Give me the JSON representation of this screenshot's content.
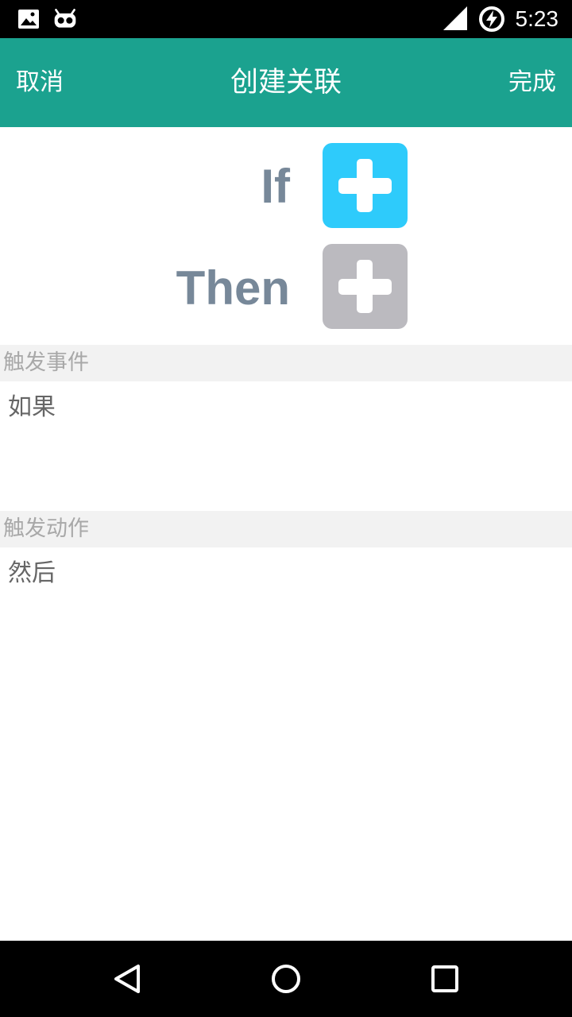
{
  "status_bar": {
    "time": "5:23",
    "icons": [
      "image-icon",
      "bot-icon",
      "signal-icon",
      "battery-charging-icon"
    ]
  },
  "app_bar": {
    "cancel_label": "取消",
    "title": "创建关联",
    "done_label": "完成",
    "color": "#1ba28f"
  },
  "rule": {
    "if_label": "If",
    "then_label": "Then",
    "if_button_color": "#2ecbfb",
    "then_button_color": "#bbbabf"
  },
  "sections": {
    "trigger_event": {
      "header": "触发事件",
      "value": "如果"
    },
    "trigger_action": {
      "header": "触发动作",
      "value": "然后"
    }
  },
  "nav_bar": {
    "buttons": [
      "back-icon",
      "home-icon",
      "recents-icon"
    ]
  }
}
